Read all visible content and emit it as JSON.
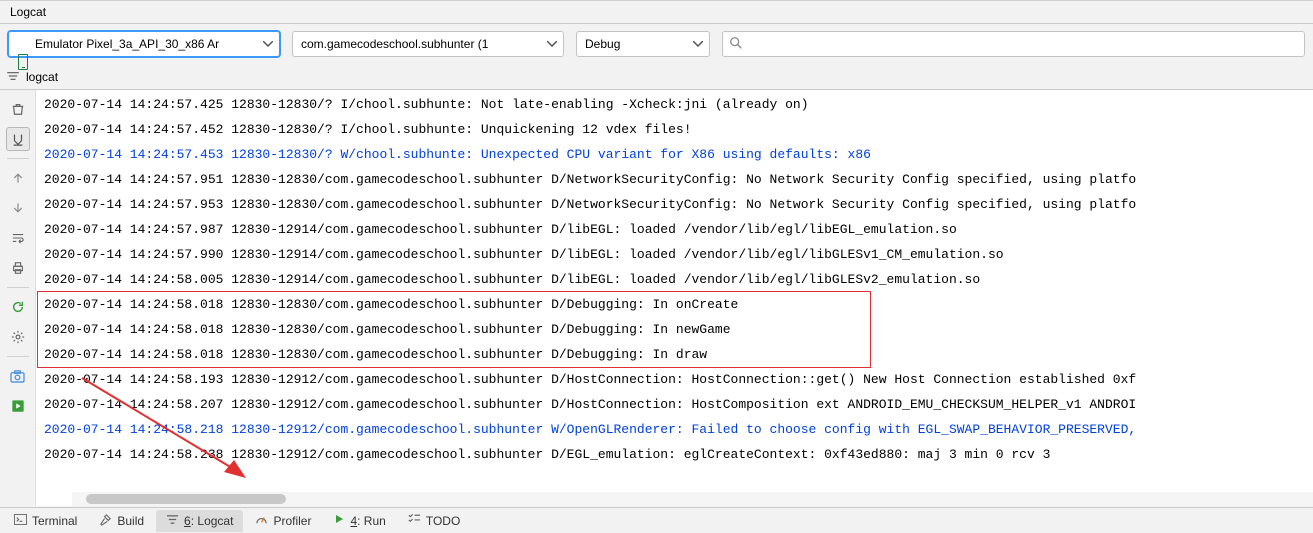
{
  "toolwindow": {
    "title": "Logcat"
  },
  "filter": {
    "device": "Emulator Pixel_3a_API_30_x86 Ar",
    "package_label": "com.gamecodeschool.subhunter (1",
    "level": "Debug",
    "search": ""
  },
  "subheader": {
    "label": "logcat"
  },
  "sidebar_icons": {
    "trash": "trash-icon",
    "scroll_end": "scroll-end-icon",
    "up": "up-arrow-icon",
    "down": "down-arrow-icon",
    "wrap": "soft-wrap-icon",
    "print": "print-icon",
    "restart": "restart-icon",
    "settings": "gear-icon",
    "screenshot": "camera-icon",
    "record": "record-icon"
  },
  "logs": [
    {
      "cls": "",
      "text": "2020-07-14 14:24:57.425 12830-12830/? I/chool.subhunte: Not late-enabling -Xcheck:jni (already on)"
    },
    {
      "cls": "",
      "text": "2020-07-14 14:24:57.452 12830-12830/? I/chool.subhunte: Unquickening 12 vdex files!"
    },
    {
      "cls": "warning",
      "text": "2020-07-14 14:24:57.453 12830-12830/? W/chool.subhunte: Unexpected CPU variant for X86 using defaults: x86"
    },
    {
      "cls": "",
      "text": "2020-07-14 14:24:57.951 12830-12830/com.gamecodeschool.subhunter D/NetworkSecurityConfig: No Network Security Config specified, using platfo"
    },
    {
      "cls": "",
      "text": "2020-07-14 14:24:57.953 12830-12830/com.gamecodeschool.subhunter D/NetworkSecurityConfig: No Network Security Config specified, using platfo"
    },
    {
      "cls": "",
      "text": "2020-07-14 14:24:57.987 12830-12914/com.gamecodeschool.subhunter D/libEGL: loaded /vendor/lib/egl/libEGL_emulation.so"
    },
    {
      "cls": "",
      "text": "2020-07-14 14:24:57.990 12830-12914/com.gamecodeschool.subhunter D/libEGL: loaded /vendor/lib/egl/libGLESv1_CM_emulation.so"
    },
    {
      "cls": "",
      "text": "2020-07-14 14:24:58.005 12830-12914/com.gamecodeschool.subhunter D/libEGL: loaded /vendor/lib/egl/libGLESv2_emulation.so"
    },
    {
      "cls": "",
      "text": "2020-07-14 14:24:58.018 12830-12830/com.gamecodeschool.subhunter D/Debugging: In onCreate"
    },
    {
      "cls": "",
      "text": "2020-07-14 14:24:58.018 12830-12830/com.gamecodeschool.subhunter D/Debugging: In newGame"
    },
    {
      "cls": "",
      "text": "2020-07-14 14:24:58.018 12830-12830/com.gamecodeschool.subhunter D/Debugging: In draw"
    },
    {
      "cls": "",
      "text": "2020-07-14 14:24:58.193 12830-12912/com.gamecodeschool.subhunter D/HostConnection: HostConnection::get() New Host Connection established 0xf"
    },
    {
      "cls": "",
      "text": "2020-07-14 14:24:58.207 12830-12912/com.gamecodeschool.subhunter D/HostConnection: HostComposition ext ANDROID_EMU_CHECKSUM_HELPER_v1 ANDROI"
    },
    {
      "cls": "warning",
      "text": "2020-07-14 14:24:58.218 12830-12912/com.gamecodeschool.subhunter W/OpenGLRenderer: Failed to choose config with EGL_SWAP_BEHAVIOR_PRESERVED,"
    },
    {
      "cls": "",
      "text": "2020-07-14 14:24:58.238 12830-12912/com.gamecodeschool.subhunter D/EGL_emulation: eglCreateContext: 0xf43ed880: maj 3 min 0 rcv 3"
    }
  ],
  "bottom": {
    "terminal": "Terminal",
    "build": "Build",
    "logcat_u": "6",
    "logcat_rest": ": Logcat",
    "profiler": "Profiler",
    "run_u": "4",
    "run_rest": ": Run",
    "todo": "TODO"
  }
}
